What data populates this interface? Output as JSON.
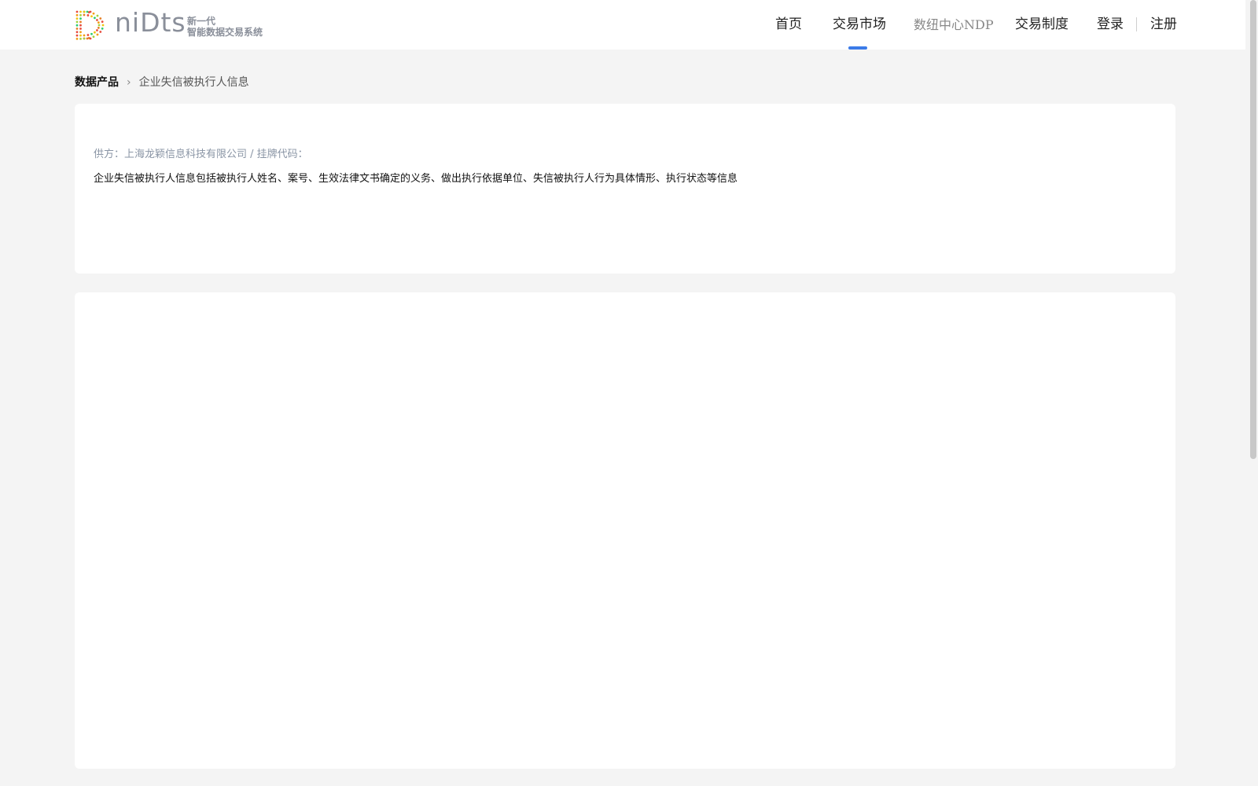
{
  "header": {
    "logo": {
      "wordmark": "niDts",
      "tagline_line1": "新一代",
      "tagline_line2": "智能数据交易系统"
    },
    "nav": [
      {
        "label": "首页"
      },
      {
        "label": "交易市场",
        "active": true
      },
      {
        "label": "数纽中心NDP"
      },
      {
        "label": "交易制度"
      }
    ],
    "login_label": "登录",
    "register_label": "注册",
    "accent_color": "#3b7be8"
  },
  "breadcrumb": {
    "root": "数据产品",
    "current": "企业失信被执行人信息"
  },
  "product": {
    "supplier_line": "供方：上海龙颖信息科技有限公司 / 挂牌代码：",
    "description": "企业失信被执行人信息包括被执行人姓名、案号、生效法律文书确定的义务、做出执行依据单位、失信被执行人行为具体情形、执行状态等信息"
  }
}
